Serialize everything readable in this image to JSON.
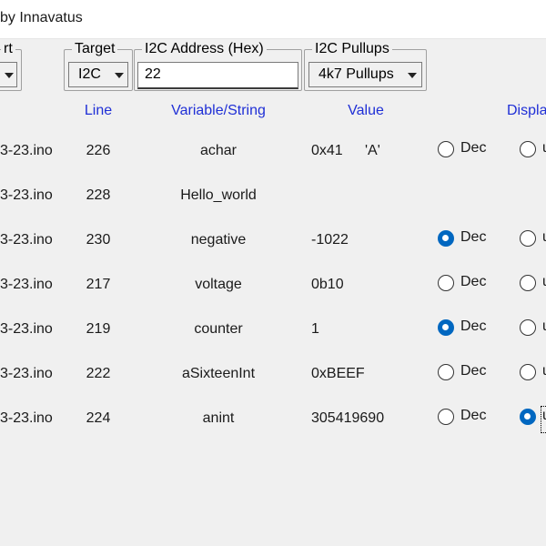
{
  "window": {
    "title": "by Innavatus"
  },
  "groups": {
    "port_legend": "rt",
    "target": {
      "legend": "Target",
      "value": "I2C"
    },
    "i2c_address": {
      "legend": "I2C Address (Hex)",
      "value": "22"
    },
    "i2c_pullups": {
      "legend": "I2C Pullups",
      "value": "4k7 Pullups"
    }
  },
  "table": {
    "headers": {
      "line": "Line",
      "variable": "Variable/String",
      "value": "Value",
      "display": "Displa"
    },
    "rows": [
      {
        "file": "3-23.ino",
        "line": "226",
        "variable": "achar",
        "value": "0x41",
        "char": "'A'",
        "dec_label": "Dec",
        "dec_selected": false,
        "u_label": "u",
        "u_selected": false
      },
      {
        "file": "3-23.ino",
        "line": "228",
        "variable": "Hello_world",
        "value": "",
        "char": "",
        "dec_label": "",
        "dec_selected": false,
        "u_label": "",
        "u_selected": false
      },
      {
        "file": "3-23.ino",
        "line": "230",
        "variable": "negative",
        "value": "-1022",
        "char": "",
        "dec_label": "Dec",
        "dec_selected": true,
        "u_label": "u",
        "u_selected": false
      },
      {
        "file": "3-23.ino",
        "line": "217",
        "variable": "voltage",
        "value": "0b10",
        "char": "",
        "dec_label": "Dec",
        "dec_selected": false,
        "u_label": "u",
        "u_selected": false
      },
      {
        "file": "3-23.ino",
        "line": "219",
        "variable": "counter",
        "value": "1",
        "char": "",
        "dec_label": "Dec",
        "dec_selected": true,
        "u_label": "u",
        "u_selected": false
      },
      {
        "file": "3-23.ino",
        "line": "222",
        "variable": "aSixteenInt",
        "value": "0xBEEF",
        "char": "",
        "dec_label": "Dec",
        "dec_selected": false,
        "u_label": "u",
        "u_selected": false
      },
      {
        "file": "3-23.ino",
        "line": "224",
        "variable": "anint",
        "value": "305419690",
        "char": "",
        "dec_label": "Dec",
        "dec_selected": false,
        "u_label": "u",
        "u_selected": true
      }
    ]
  },
  "colors": {
    "header_text": "#1f2fd6",
    "radio_selected": "#0067c0",
    "background": "#f0f0f0"
  },
  "icons": {
    "dropdown": "chevron-down-icon",
    "radio": "radio-button"
  }
}
